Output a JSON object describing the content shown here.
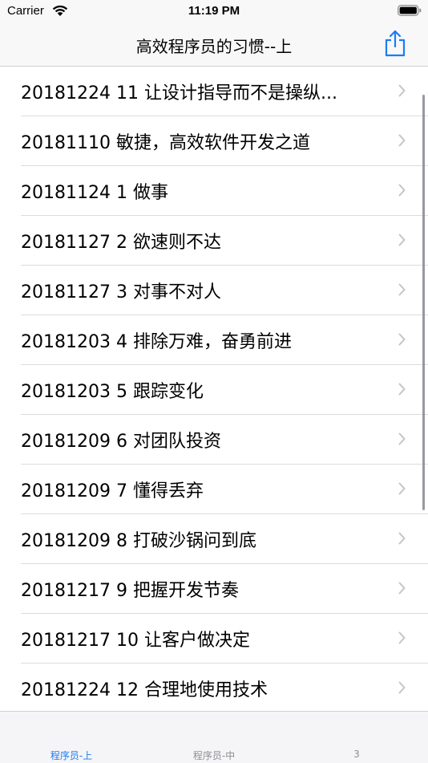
{
  "status_bar": {
    "carrier": "Carrier",
    "time": "11:19 PM"
  },
  "nav": {
    "title": "高效程序员的习惯--上",
    "share_icon": "share-icon"
  },
  "rows": [
    {
      "label": "20181224 11 让设计指导而不是操纵..."
    },
    {
      "label": "20181110 敏捷，高效软件开发之道"
    },
    {
      "label": "20181124 1 做事"
    },
    {
      "label": "20181127 2 欲速则不达"
    },
    {
      "label": "20181127 3 对事不对人"
    },
    {
      "label": "20181203 4 排除万难，奋勇前进"
    },
    {
      "label": "20181203 5 跟踪变化"
    },
    {
      "label": "20181209 6 对团队投资"
    },
    {
      "label": "20181209 7 懂得丢弃"
    },
    {
      "label": "20181209 8 打破沙锅问到底"
    },
    {
      "label": "20181217 9 把握开发节奏"
    },
    {
      "label": "20181217 10 让客户做决定"
    },
    {
      "label": "20181224 12 合理地使用技术"
    }
  ],
  "tabs": [
    {
      "label": "程序员-上",
      "selected": true
    },
    {
      "label": "程序员-中",
      "selected": false
    },
    {
      "label": "3",
      "selected": false
    }
  ],
  "colors": {
    "accent": "#1b7cf4",
    "inactive": "#8e8e93",
    "separator": "#dcdcdf",
    "chevron": "#c4c4c7"
  }
}
